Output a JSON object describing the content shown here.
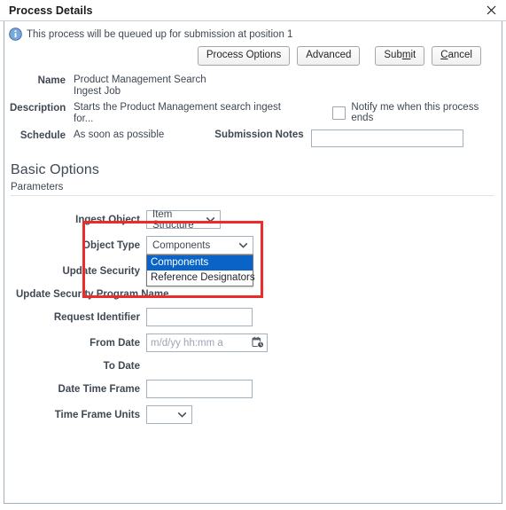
{
  "window": {
    "title": "Process Details",
    "close_icon": "close-icon"
  },
  "info": {
    "icon": "info-circle-icon",
    "message": "This process will be queued up for submission at position 1"
  },
  "toolbar": {
    "buttons": [
      {
        "label": "Process Options",
        "accesskey": ""
      },
      {
        "label": "Advanced",
        "accesskey": ""
      },
      {
        "label": "Submit",
        "accesskey": "m"
      },
      {
        "label": "Cancel",
        "accesskey": "C"
      }
    ]
  },
  "header_fields": {
    "name_label": "Name",
    "name_value_line1": "Product Management Search",
    "name_value_line2": "Ingest Job",
    "description_label": "Description",
    "description_value": "Starts the Product Management search ingest for...",
    "notify_checkbox_label": "Notify me when this process ends",
    "notify_checked": false,
    "schedule_label": "Schedule",
    "schedule_value": "As soon as possible",
    "submission_notes_label": "Submission Notes",
    "submission_notes_value": "",
    "submission_notes_placeholder": ""
  },
  "basic_options": {
    "section_title": "Basic Options",
    "parameters_label": "Parameters"
  },
  "parameters": {
    "ingest_object": {
      "label": "Ingest Object",
      "value": "Item Structure"
    },
    "object_type": {
      "label": "Object Type",
      "value": "Components",
      "open": true,
      "options": [
        "Components",
        "Reference Designators"
      ],
      "selected_index": 0
    },
    "update_security": {
      "label": "Update Security"
    },
    "update_security_program_name": {
      "label": "Update Security Program Name"
    },
    "request_identifier": {
      "label": "Request Identifier",
      "value": "",
      "placeholder": ""
    },
    "from_date": {
      "label": "From Date",
      "value": "",
      "placeholder": "m/d/yy hh:mm a",
      "icon": "calendar-clock-icon"
    },
    "to_date": {
      "label": "To Date"
    },
    "date_time_frame": {
      "label": "Date Time Frame",
      "value": "",
      "placeholder": ""
    },
    "time_frame_units": {
      "label": "Time Frame Units",
      "value": ""
    }
  },
  "annotation": {
    "highlight_color": "#ee2b2b"
  }
}
